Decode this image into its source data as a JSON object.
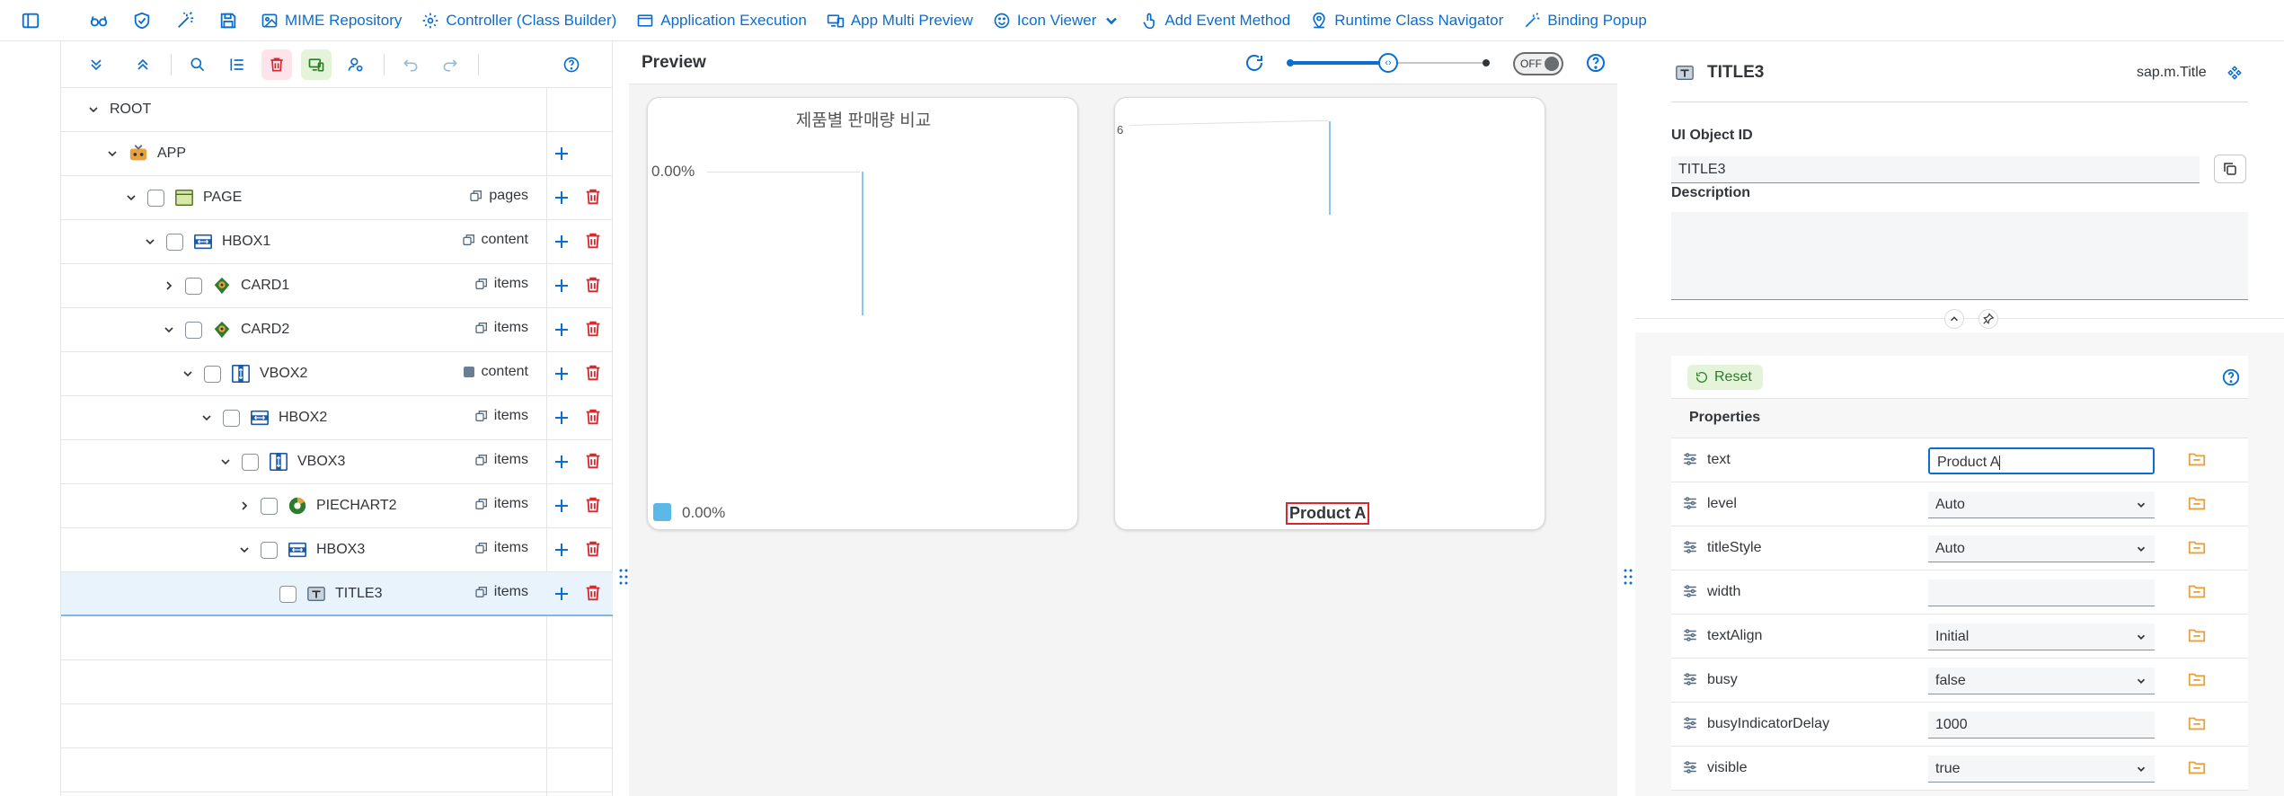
{
  "toolbar": {
    "items": [
      {
        "label": "MIME Repository",
        "icon": "image-icon"
      },
      {
        "label": "Controller (Class Builder)",
        "icon": "gear-icon"
      },
      {
        "label": "Application Execution",
        "icon": "window-icon"
      },
      {
        "label": "App Multi Preview",
        "icon": "devices-icon"
      },
      {
        "label": "Icon Viewer",
        "icon": "smiley-icon"
      },
      {
        "label": "Add Event Method",
        "icon": "touch-icon"
      },
      {
        "label": "Runtime Class Navigator",
        "icon": "location-icon"
      },
      {
        "label": "Binding Popup",
        "icon": "wand-icon"
      }
    ]
  },
  "tree": {
    "rows": [
      {
        "label": "ROOT",
        "depth": 0,
        "expanded": true,
        "checkbox": false,
        "icon": "",
        "agg": "",
        "actions": false
      },
      {
        "label": "APP",
        "depth": 1,
        "expanded": true,
        "checkbox": false,
        "icon": "app-icon",
        "agg": "",
        "actions": true,
        "delete": false
      },
      {
        "label": "PAGE",
        "depth": 2,
        "expanded": true,
        "checkbox": true,
        "icon": "page-icon",
        "agg": "pages",
        "actions": true
      },
      {
        "label": "HBOX1",
        "depth": 3,
        "expanded": true,
        "checkbox": true,
        "icon": "hbox-icon",
        "agg": "content",
        "actions": true
      },
      {
        "label": "CARD1",
        "depth": 4,
        "expanded": false,
        "checkbox": true,
        "icon": "card-icon",
        "agg": "items",
        "actions": true
      },
      {
        "label": "CARD2",
        "depth": 4,
        "expanded": true,
        "checkbox": true,
        "icon": "card-icon",
        "agg": "items",
        "actions": true
      },
      {
        "label": "VBOX2",
        "depth": 5,
        "expanded": true,
        "checkbox": true,
        "icon": "vbox-icon",
        "agg": "content",
        "actions": true
      },
      {
        "label": "HBOX2",
        "depth": 6,
        "expanded": true,
        "checkbox": true,
        "icon": "hbox-icon",
        "agg": "items",
        "actions": true
      },
      {
        "label": "VBOX3",
        "depth": 7,
        "expanded": true,
        "checkbox": true,
        "icon": "vbox-icon",
        "agg": "items",
        "actions": true
      },
      {
        "label": "PIECHART2",
        "depth": 8,
        "expanded": false,
        "checkbox": true,
        "icon": "chart-icon",
        "agg": "items",
        "actions": true
      },
      {
        "label": "HBOX3",
        "depth": 8,
        "expanded": true,
        "checkbox": true,
        "icon": "hbox-icon",
        "agg": "items",
        "actions": true
      },
      {
        "label": "TITLE3",
        "depth": 9,
        "expanded": null,
        "checkbox": true,
        "icon": "title-icon",
        "agg": "items",
        "actions": true,
        "selected": true
      }
    ]
  },
  "preview": {
    "title": "Preview",
    "toggle_label": "OFF",
    "slider_value": 0.5,
    "card1": {
      "title": "제품별 판매량 비교",
      "axis_label": "0.00%",
      "legend_label": "0.00%",
      "legend_color": "#5cb8e6"
    },
    "card2": {
      "axis_fragment": "6",
      "selected_title": "Product A"
    }
  },
  "props": {
    "object_name": "TITLE3",
    "object_class": "sap.m.Title",
    "id_label": "UI Object ID",
    "id_value": "TITLE3",
    "desc_label": "Description",
    "desc_value": "",
    "reset_label": "Reset",
    "section_label": "Properties",
    "rows": [
      {
        "name": "text",
        "value": "Product A",
        "type": "input",
        "focused": true
      },
      {
        "name": "level",
        "value": "Auto",
        "type": "select"
      },
      {
        "name": "titleStyle",
        "value": "Auto",
        "type": "select"
      },
      {
        "name": "width",
        "value": "",
        "type": "input"
      },
      {
        "name": "textAlign",
        "value": "Initial",
        "type": "select"
      },
      {
        "name": "busy",
        "value": "false",
        "type": "select"
      },
      {
        "name": "busyIndicatorDelay",
        "value": "1000",
        "type": "input"
      },
      {
        "name": "visible",
        "value": "true",
        "type": "select"
      }
    ]
  }
}
